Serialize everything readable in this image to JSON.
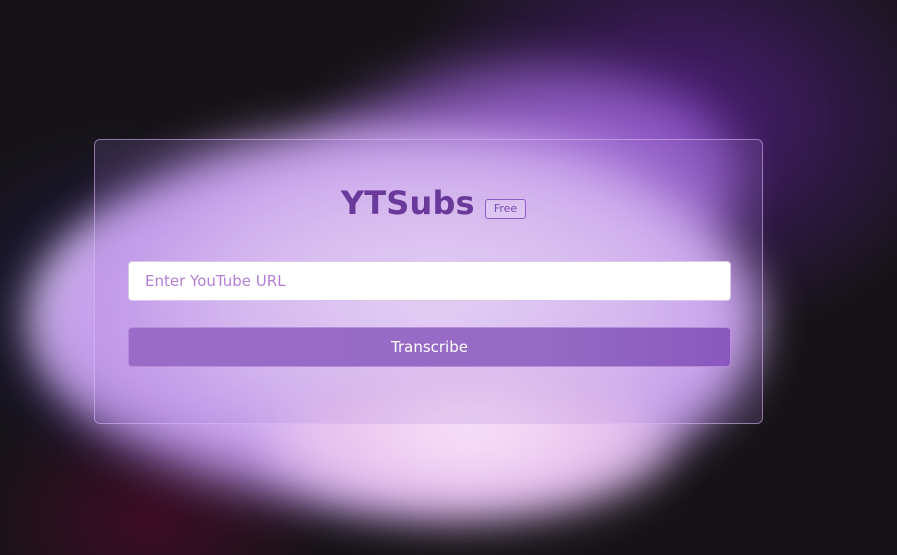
{
  "app": {
    "title": "YTSubs",
    "badge": "Free"
  },
  "form": {
    "url_input": {
      "value": "",
      "placeholder": "Enter YouTube URL"
    },
    "submit_label": "Transcribe"
  },
  "colors": {
    "background": "#161317",
    "title": "#6a3a9a",
    "button": "#9a6cc7",
    "placeholder": "#b57ed8"
  }
}
